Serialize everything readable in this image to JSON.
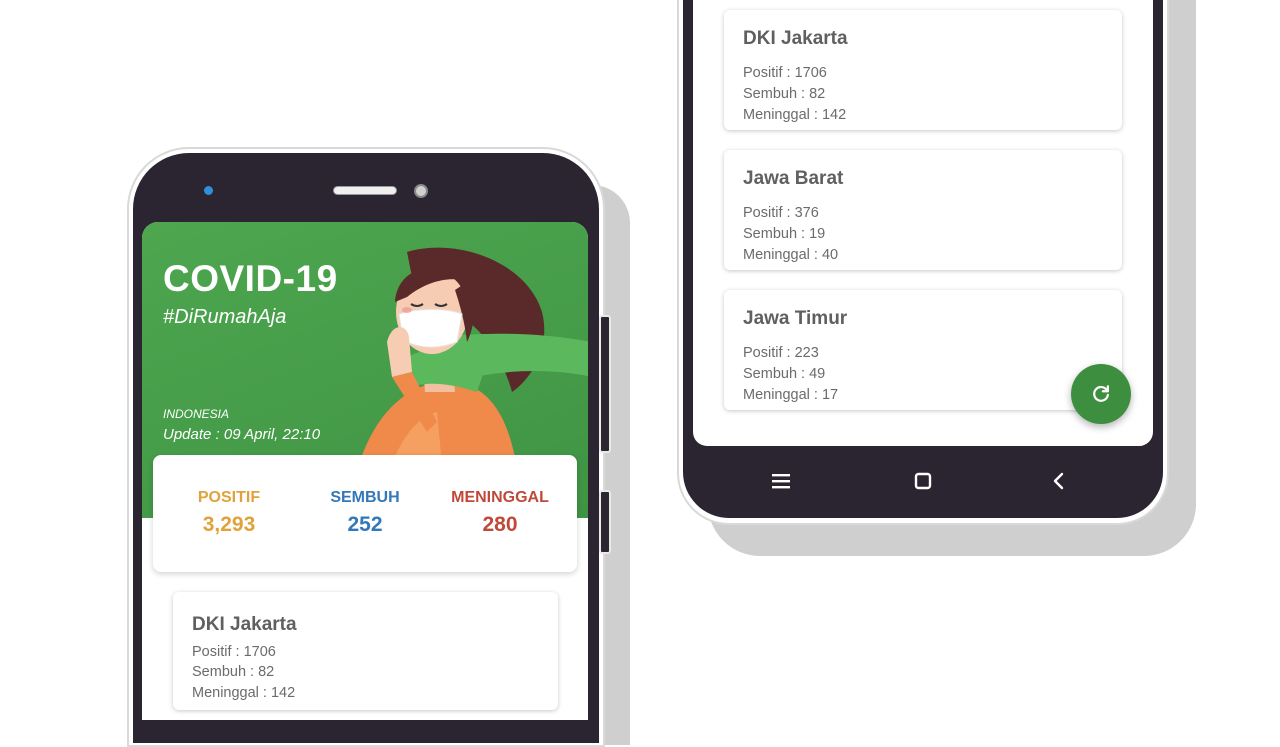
{
  "left_phone": {
    "header": {
      "title": "COVID-19",
      "hashtag": "#DiRumahAja",
      "country": "INDONESIA",
      "update": "Update : 09 April, 22:10"
    },
    "summary": {
      "positif_label": "POSITIF",
      "positif_value": "3,293",
      "sembuh_label": "SEMBUH",
      "sembuh_value": "252",
      "meninggal_label": "MENINGGAL",
      "meninggal_value": "280"
    },
    "provinces": [
      {
        "name": "DKI Jakarta",
        "positif": "Positif : 1706",
        "sembuh": "Sembuh : 82",
        "meninggal": "Meninggal : 142"
      }
    ]
  },
  "right_phone": {
    "provinces": [
      {
        "name": "DKI Jakarta",
        "positif": "Positif : 1706",
        "sembuh": "Sembuh : 82",
        "meninggal": "Meninggal : 142"
      },
      {
        "name": "Jawa Barat",
        "positif": "Positif : 376",
        "sembuh": "Sembuh : 19",
        "meninggal": "Meninggal : 40"
      },
      {
        "name": "Jawa Timur",
        "positif": "Positif : 223",
        "sembuh": "Sembuh : 49",
        "meninggal": "Meninggal : 17"
      }
    ],
    "fab_icon": "refresh-icon",
    "nav": [
      "menu-icon",
      "home-icon",
      "back-icon"
    ]
  },
  "colors": {
    "header_green": "#4ea64f",
    "positif": "#e0a23a",
    "sembuh": "#3378b8",
    "meninggal": "#bf4a3a",
    "fab": "#3d8f3f"
  }
}
